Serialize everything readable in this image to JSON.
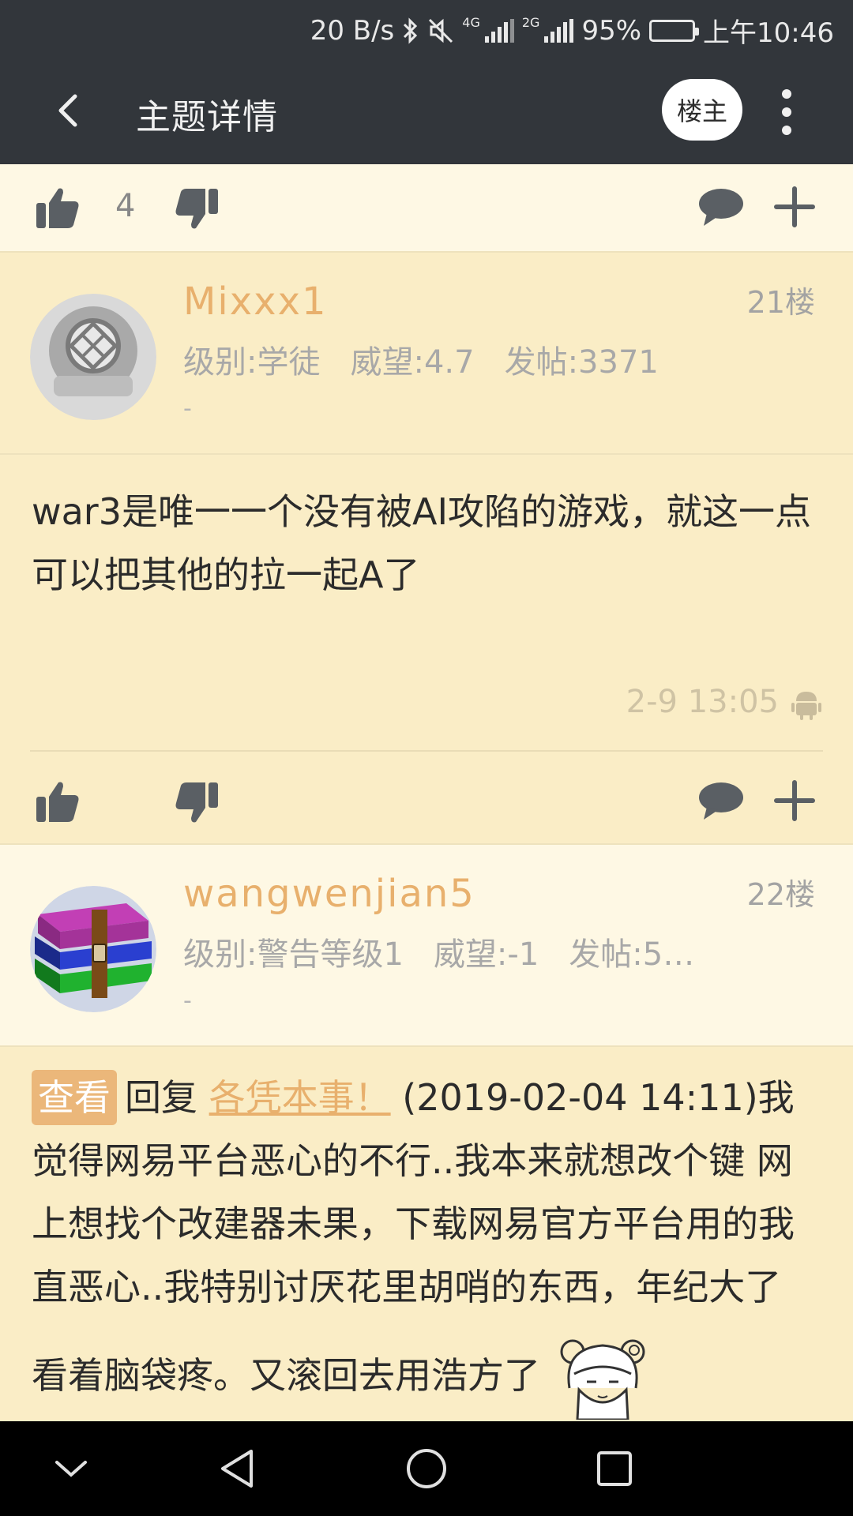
{
  "status_bar": {
    "speed": "20 B/s",
    "net_4g": "4G",
    "net_2g": "2G",
    "battery": "95%",
    "time": "上午10:46"
  },
  "header": {
    "title": "主题详情",
    "owner_button": "楼主"
  },
  "top_actions": {
    "like_count": "4"
  },
  "posts": [
    {
      "username": "Mixxx1",
      "floor": "21楼",
      "level": "级别:学徒",
      "prestige": "威望:4.7",
      "posts": "发帖:3371",
      "dash": "-",
      "content": "war3是唯一一个没有被AI攻陷的游戏，就这一点可以把其他的拉一起A了",
      "time": "2-9 13:05"
    },
    {
      "username": "wangwenjian5",
      "floor": "22楼",
      "level": "级别:警告等级1",
      "prestige": "威望:-1",
      "posts": "发帖:5…",
      "dash": "-",
      "reply_tag": "查看",
      "reply_word": "回复",
      "reply_user": "各凭本事！",
      "content_line1": "(2019-02-04 14:11)我觉得网易平台恶心的不行..我本来就想改个键 网上想找个改建器未果，下载网易官方平台用的我直恶心..我特别讨厌花里胡哨的东西，年纪大了",
      "content_line2": "看着脑袋疼。又滚回去用浩方了"
    }
  ]
}
